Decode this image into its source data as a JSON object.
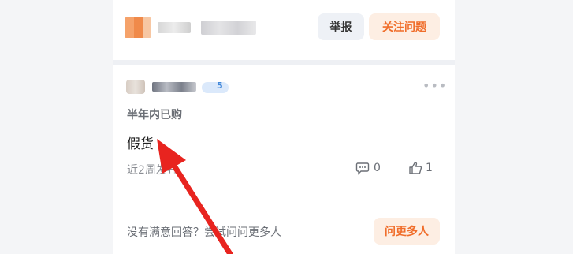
{
  "header": {
    "report_label": "举报",
    "follow_label": "关注问题"
  },
  "answer": {
    "user_level": "5",
    "purchase_tag": "半年内已购",
    "content": "假货",
    "time": "近2周发布",
    "comment_count": "0",
    "like_count": "1"
  },
  "footer": {
    "hint": "没有满意回答？尝试问问更多人",
    "ask_more_label": "问更多人"
  },
  "colors": {
    "accent": "#f06d2a",
    "accent_bg": "#fdeee3",
    "annotation_arrow": "#e8241f"
  },
  "icons": {
    "comment": "comment-icon",
    "like": "thumbs-up-icon",
    "more": "more-icon"
  }
}
